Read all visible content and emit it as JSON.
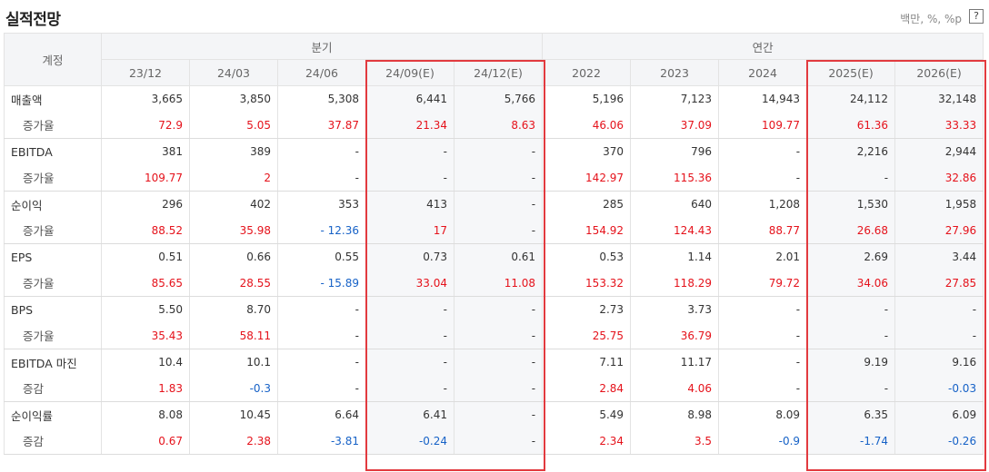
{
  "header": {
    "title": "실적전망",
    "unit": "백만, %, %p",
    "help": "?"
  },
  "table": {
    "account_label": "계정",
    "groups": [
      {
        "label": "분기"
      },
      {
        "label": "연간"
      }
    ],
    "periods": [
      "23/12",
      "24/03",
      "24/06",
      "24/09(E)",
      "24/12(E)",
      "2022",
      "2023",
      "2024",
      "2025(E)",
      "2026(E)"
    ],
    "rows": [
      {
        "label": "매출액",
        "values": [
          "3,665",
          "3,850",
          "5,308",
          "6,441",
          "5,766",
          "5,196",
          "7,123",
          "14,943",
          "24,112",
          "32,148"
        ]
      },
      {
        "label": "증가율",
        "values": [
          "72.9",
          "5.05",
          "37.87",
          "21.34",
          "8.63",
          "46.06",
          "37.09",
          "109.77",
          "61.36",
          "33.33"
        ]
      },
      {
        "label": "EBITDA",
        "values": [
          "381",
          "389",
          "-",
          "-",
          "-",
          "370",
          "796",
          "-",
          "2,216",
          "2,944"
        ]
      },
      {
        "label": "증가율",
        "values": [
          "109.77",
          "2",
          "-",
          "-",
          "-",
          "142.97",
          "115.36",
          "-",
          "-",
          "32.86"
        ]
      },
      {
        "label": "순이익",
        "values": [
          "296",
          "402",
          "353",
          "413",
          "-",
          "285",
          "640",
          "1,208",
          "1,530",
          "1,958"
        ]
      },
      {
        "label": "증가율",
        "values": [
          "88.52",
          "35.98",
          "- 12.36",
          "17",
          "-",
          "154.92",
          "124.43",
          "88.77",
          "26.68",
          "27.96"
        ]
      },
      {
        "label": "EPS",
        "values": [
          "0.51",
          "0.66",
          "0.55",
          "0.73",
          "0.61",
          "0.53",
          "1.14",
          "2.01",
          "2.69",
          "3.44"
        ]
      },
      {
        "label": "증가율",
        "values": [
          "85.65",
          "28.55",
          "- 15.89",
          "33.04",
          "11.08",
          "153.32",
          "118.29",
          "79.72",
          "34.06",
          "27.85"
        ]
      },
      {
        "label": "BPS",
        "values": [
          "5.50",
          "8.70",
          "-",
          "-",
          "-",
          "2.73",
          "3.73",
          "-",
          "-",
          "-"
        ]
      },
      {
        "label": "증가율",
        "values": [
          "35.43",
          "58.11",
          "-",
          "-",
          "-",
          "25.75",
          "36.79",
          "-",
          "-",
          "-"
        ]
      },
      {
        "label": "EBITDA 마진",
        "values": [
          "10.4",
          "10.1",
          "-",
          "-",
          "-",
          "7.11",
          "11.17",
          "-",
          "9.19",
          "9.16"
        ]
      },
      {
        "label": "증감",
        "values": [
          "1.83",
          "-0.3",
          "-",
          "-",
          "-",
          "2.84",
          "4.06",
          "-",
          "-",
          "-0.03"
        ]
      },
      {
        "label": "순이익률",
        "values": [
          "8.08",
          "10.45",
          "6.64",
          "6.41",
          "-",
          "5.49",
          "8.98",
          "8.09",
          "6.35",
          "6.09"
        ]
      },
      {
        "label": "증감",
        "values": [
          "0.67",
          "2.38",
          "-3.81",
          "-0.24",
          "-",
          "2.34",
          "3.5",
          "-0.9",
          "-1.74",
          "-0.26"
        ]
      }
    ]
  },
  "colors": {
    "positive": "#e5121b",
    "negative": "#1762c7",
    "highlight_box": "#e23a3f"
  }
}
